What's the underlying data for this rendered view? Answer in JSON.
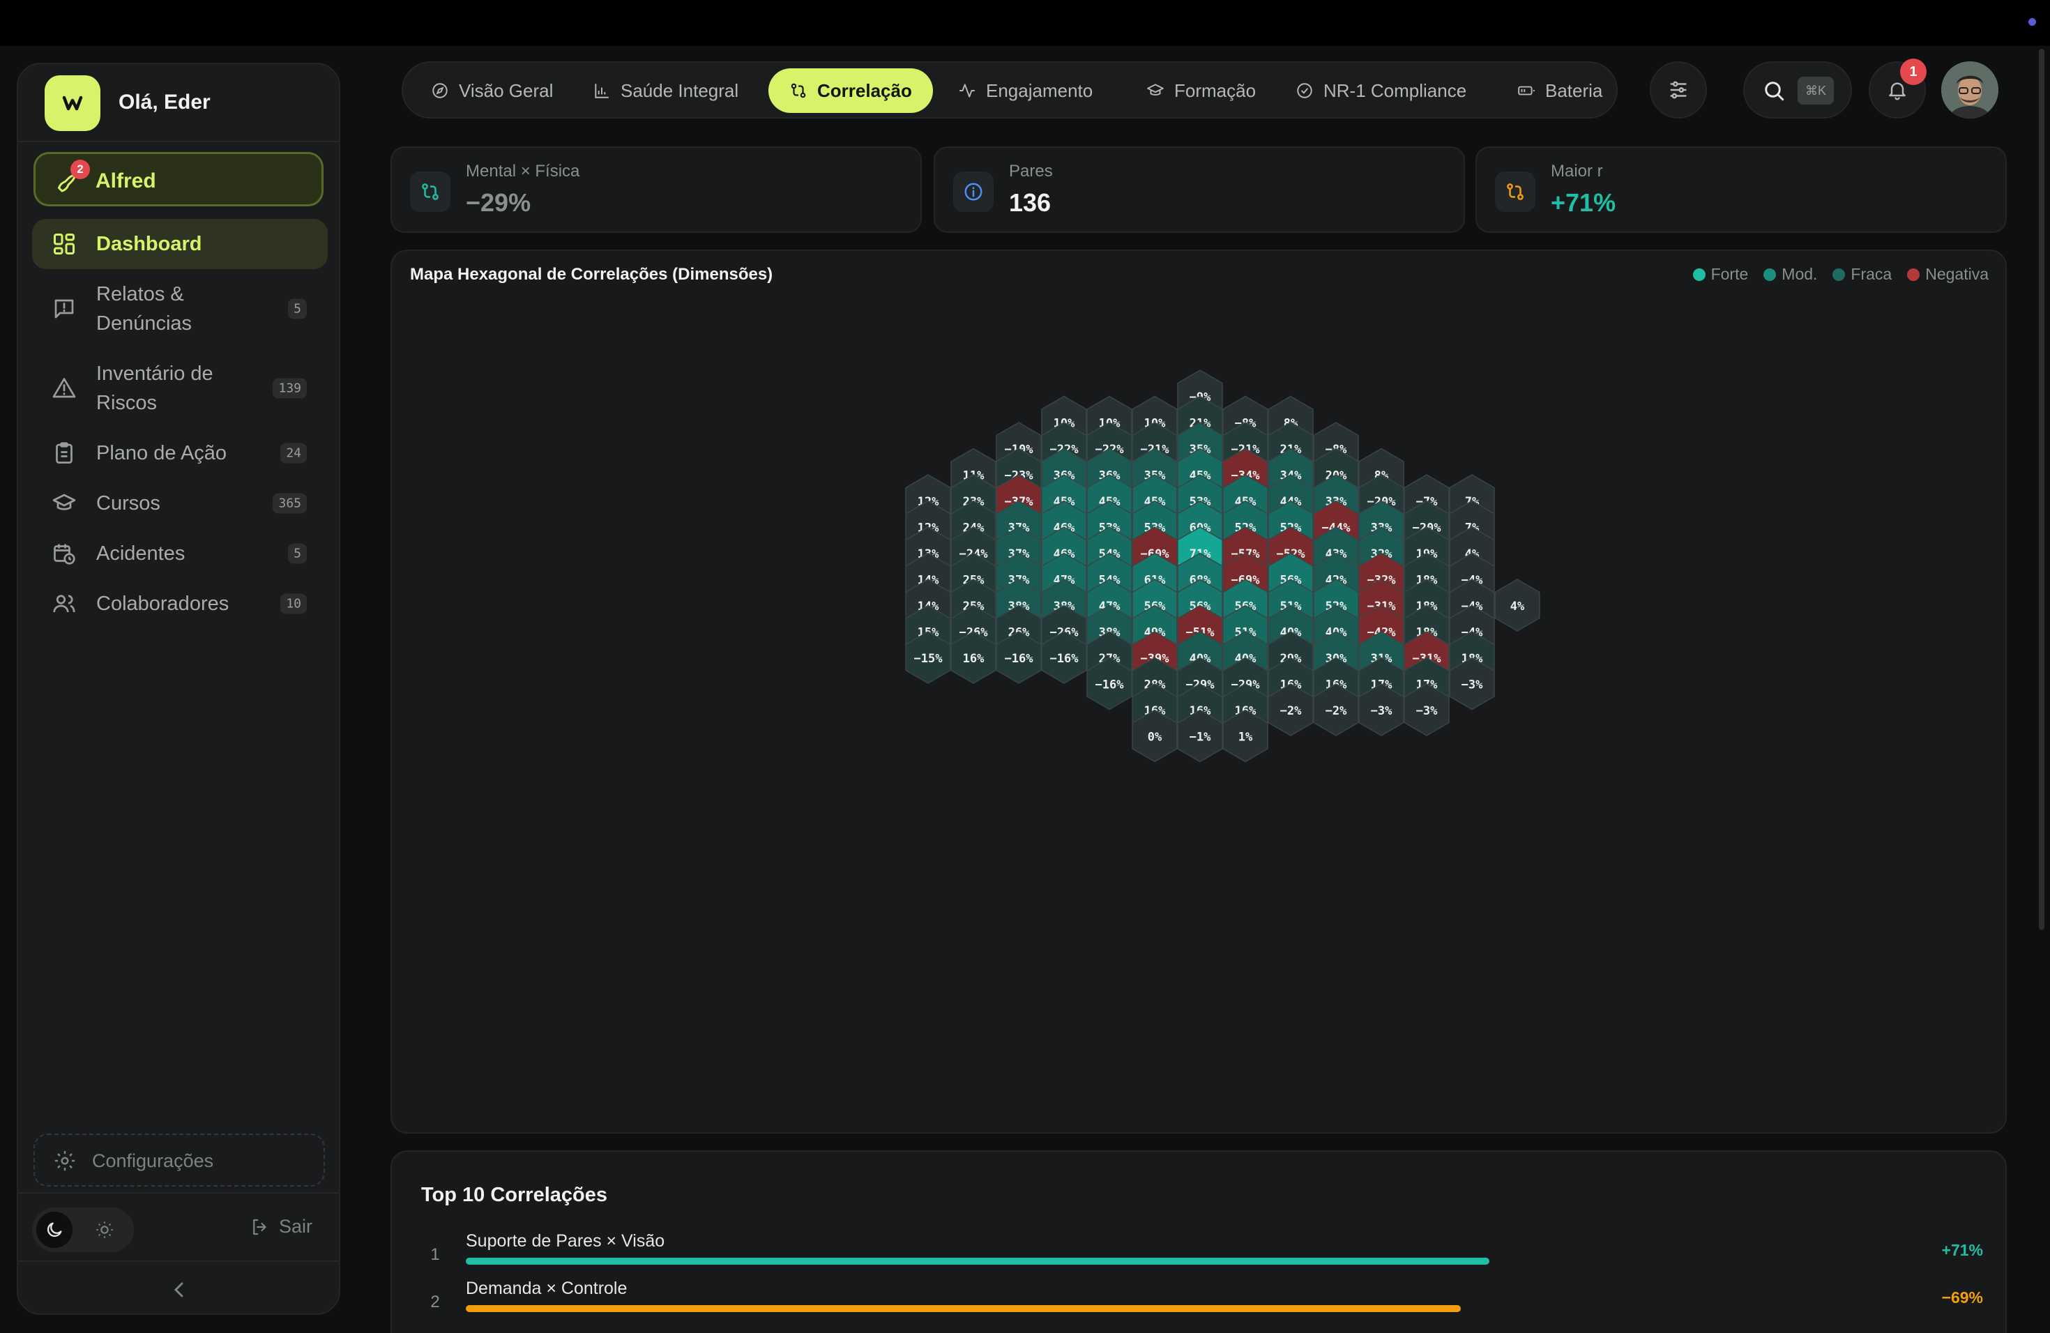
{
  "user": {
    "greeting": "Olá, Eder"
  },
  "sidebar": {
    "alfred": {
      "label": "Alfred",
      "badge": "2"
    },
    "items": [
      {
        "label": "Dashboard",
        "count": "",
        "icon": "dashboard-icon",
        "active": true
      },
      {
        "label": "Relatos & Denúncias",
        "count": "5",
        "icon": "message-alert-icon"
      },
      {
        "label": "Inventário de Riscos",
        "count": "139",
        "icon": "warning-icon"
      },
      {
        "label": "Plano de Ação",
        "count": "24",
        "icon": "clipboard-icon"
      },
      {
        "label": "Cursos",
        "count": "365",
        "icon": "graduation-cap-icon"
      },
      {
        "label": "Acidentes",
        "count": "5",
        "icon": "calendar-clock-icon"
      },
      {
        "label": "Colaboradores",
        "count": "10",
        "icon": "users-icon"
      }
    ],
    "settings_label": "Configurações",
    "logout_label": "Sair"
  },
  "tabs": [
    {
      "label": "Visão Geral",
      "icon": "compass-icon"
    },
    {
      "label": "Saúde Integral",
      "icon": "bar-chart-icon"
    },
    {
      "label": "Correlação",
      "icon": "git-compare-icon",
      "active": true
    },
    {
      "label": "Engajamento",
      "icon": "activity-icon"
    },
    {
      "label": "Formação",
      "icon": "graduation-cap-icon"
    },
    {
      "label": "NR-1 Compliance",
      "icon": "check-circle-icon"
    },
    {
      "label": "Bateria",
      "icon": "battery-icon"
    }
  ],
  "header": {
    "search_shortcut": "⌘K",
    "notifications_count": "1"
  },
  "stats": [
    {
      "title": "Mental × Física",
      "value": "−29%",
      "color": "#8b8f8d",
      "icon": "git-compare-icon",
      "icon_color": "#1fbfa6"
    },
    {
      "title": "Pares",
      "value": "136",
      "color": "#f2f2f2",
      "icon": "info-icon",
      "icon_color": "#4f8ef7"
    },
    {
      "title": "Maior r",
      "value": "+71%",
      "color": "#1fbfa6",
      "icon": "git-compare-icon",
      "icon_color": "#f59e0b"
    }
  ],
  "hexmap": {
    "title": "Mapa Hexagonal de Correlações (Dimensões)",
    "legend": [
      {
        "label": "Forte",
        "color": "#1fbfa6"
      },
      {
        "label": "Mod.",
        "color": "#1a8f80"
      },
      {
        "label": "Fraca",
        "color": "#1f6b62"
      },
      {
        "label": "Negativa",
        "color": "#b23a3a"
      }
    ],
    "columns": [
      [
        12,
        12,
        13,
        14,
        14,
        15,
        -15
      ],
      [
        11,
        23,
        24,
        -24,
        25,
        25,
        -26,
        16
      ],
      [
        -10,
        -23,
        -37,
        37,
        37,
        37,
        38,
        26,
        -16
      ],
      [
        10,
        -22,
        36,
        45,
        46,
        46,
        47,
        38,
        -26,
        -16
      ],
      [
        10,
        -22,
        36,
        45,
        53,
        54,
        54,
        47,
        38,
        27,
        -16
      ],
      [
        10,
        -21,
        35,
        45,
        53,
        -60,
        61,
        56,
        49,
        -39,
        28,
        16,
        0
      ],
      [
        -9,
        21,
        35,
        45,
        53,
        60,
        71,
        68,
        56,
        -51,
        40,
        -29,
        16,
        -1
      ],
      [
        -8,
        -21,
        -34,
        45,
        52,
        -57,
        -69,
        56,
        51,
        40,
        -29,
        16,
        1
      ],
      [
        8,
        21,
        34,
        44,
        52,
        -52,
        56,
        51,
        40,
        29,
        16,
        -2
      ],
      [
        -8,
        20,
        33,
        -44,
        43,
        42,
        52,
        40,
        30,
        16,
        -2
      ],
      [
        8,
        -20,
        33,
        32,
        -32,
        -31,
        -42,
        31,
        17,
        -3
      ],
      [
        -7,
        -20,
        19,
        18,
        18,
        18,
        -31,
        17,
        -3
      ],
      [
        7,
        7,
        4,
        -4,
        -4,
        -4,
        18,
        -3
      ],
      [
        4
      ]
    ]
  },
  "top10": {
    "title": "Top 10 Correlações",
    "items": [
      {
        "rank": "1",
        "name": "Suporte de Pares × Visão",
        "value": "+71%",
        "fraction": 0.71,
        "color": "#1fbfa6"
      },
      {
        "rank": "2",
        "name": "Demanda × Controle",
        "value": "−69%",
        "fraction": 0.69,
        "color": "#f59e0b"
      }
    ]
  }
}
